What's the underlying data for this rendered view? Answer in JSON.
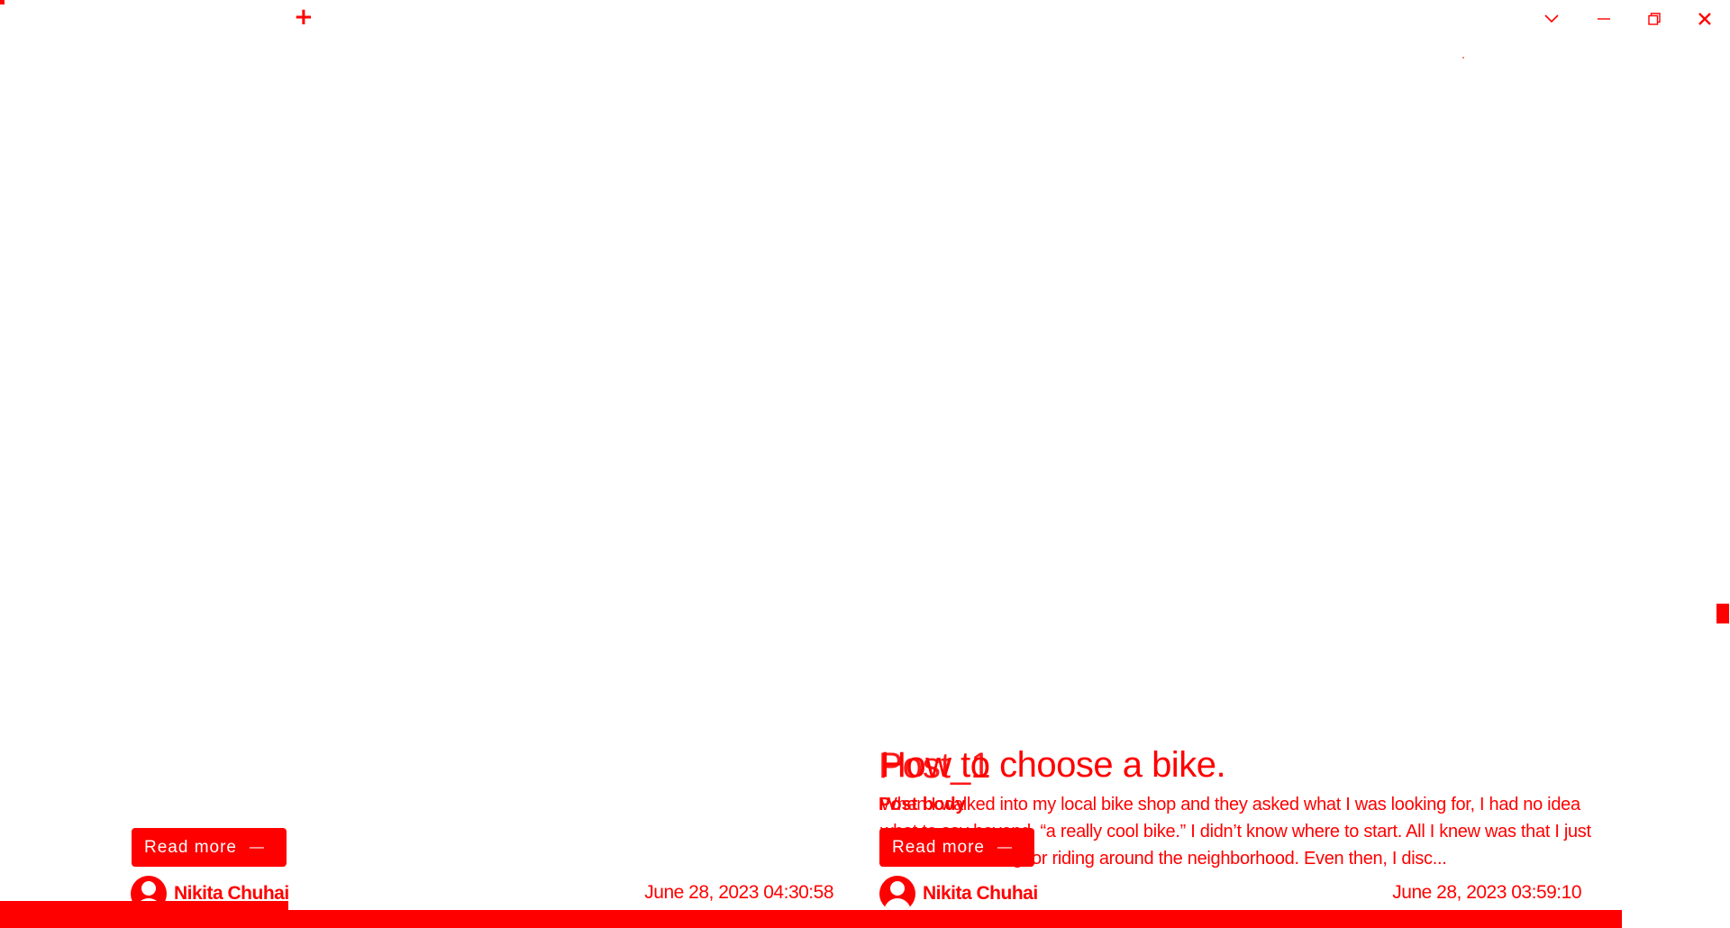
{
  "window": {
    "new_tab_glyph": "+",
    "icons": [
      "chevron-down-icon",
      "minimize-icon",
      "restore-icon",
      "close-icon"
    ]
  },
  "posts": [
    {
      "read_more_label": "Read more",
      "read_more_glyph": "—",
      "author": "Nikita Chuhai",
      "date": "June 28, 2023 04:30:58"
    },
    {
      "title": "How to choose a bike.",
      "title_overlap": "Post_1",
      "excerpt": "When I walked into my local bike shop and they asked what I was looking for, I had no idea what to say beyond, “a really cool bike.” I didn’t know where to start. All I knew was that I just wanted something for riding around the neighborhood. Even then, I disc...",
      "excerpt_overlap": "Post body",
      "read_more_label": "Read more",
      "read_more_glyph": "—",
      "author": "Nikita Chuhai",
      "date": "June 28, 2023 03:59:10"
    }
  ],
  "colors": {
    "accent": "#ff0000",
    "background": "#ffffff",
    "button_text": "#ffffff"
  }
}
